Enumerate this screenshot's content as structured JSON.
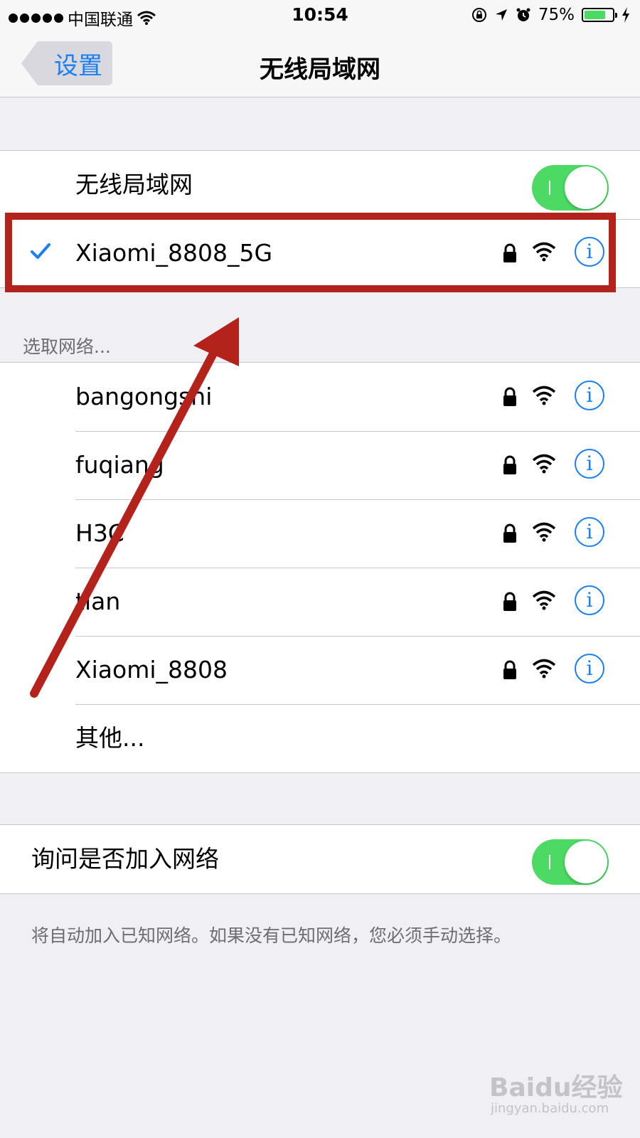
{
  "status_bar": {
    "carrier": "中国联通",
    "time": "10:54",
    "battery_percent": "75%",
    "battery_level": 0.75,
    "icons": [
      "signal-dots-icon",
      "wifi-icon",
      "orientation-lock-icon",
      "location-icon",
      "alarm-icon",
      "battery-icon",
      "charging-icon"
    ]
  },
  "nav": {
    "back_label": "设置",
    "title": "无线局域网"
  },
  "wifi_toggle": {
    "label": "无线局域网",
    "on": true
  },
  "connected_network": {
    "name": "Xiaomi_8808_5G",
    "connected": true,
    "locked": true
  },
  "choose_network_header": "选取网络...",
  "networks": [
    {
      "name": "bangongshi",
      "locked": true
    },
    {
      "name": "fuqiang",
      "locked": true
    },
    {
      "name": "H3C",
      "locked": true
    },
    {
      "name": "tian",
      "locked": true
    },
    {
      "name": "Xiaomi_8808",
      "locked": true
    }
  ],
  "other_label": "其他...",
  "ask_to_join": {
    "label": "询问是否加入网络",
    "on": true
  },
  "ask_to_join_note": "将自动加入已知网络。如果没有已知网络，您必须手动选择。",
  "info_glyph": "i",
  "watermark": {
    "brand": "Baidu经验",
    "url": "jingyan.baidu.com"
  },
  "colors": {
    "accent": "#1a7ff2",
    "toggle_on": "#4cd964",
    "highlight": "#b4221c",
    "background": "#efeff4"
  }
}
